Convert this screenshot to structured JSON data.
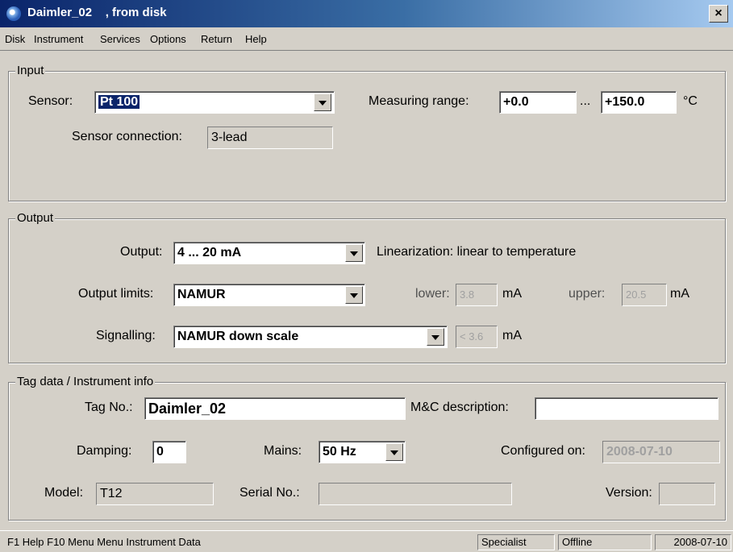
{
  "window": {
    "title": "Daimler_02    , from disk",
    "close": "×"
  },
  "menu": [
    "Disk",
    "Instrument",
    "Services",
    "Options",
    "Return",
    "Help"
  ],
  "input": {
    "legend": "Input",
    "sensor_label": "Sensor:",
    "sensor_value": "Pt 100",
    "range_label": "Measuring range:",
    "range_from": "+0.0",
    "range_sep": "...",
    "range_to": "+150.0",
    "range_unit": "°C",
    "connection_label": "Sensor connection:",
    "connection_value": "3-lead"
  },
  "output": {
    "legend": "Output",
    "output_label": "Output:",
    "output_value": "4 ... 20 mA",
    "linearization": "Linearization: linear to temperature",
    "limits_label": "Output limits:",
    "limits_value": "NAMUR",
    "lower_label": "lower:",
    "lower_value": "3.8",
    "lower_unit": "mA",
    "upper_label": "upper:",
    "upper_value": "20.5",
    "upper_unit": "mA",
    "signalling_label": "Signalling:",
    "signalling_value": "NAMUR down scale",
    "signal_value": "< 3.6",
    "signal_unit": "mA"
  },
  "tag": {
    "legend": "Tag data / Instrument info",
    "tagno_label": "Tag No.:",
    "tagno_value": "Daimler_02",
    "mc_label": "M&C description:",
    "mc_value": "",
    "damping_label": "Damping:",
    "damping_value": "0",
    "mains_label": "Mains:",
    "mains_value": "50 Hz",
    "configured_label": "Configured on:",
    "configured_value": "2008-07-10",
    "model_label": "Model:",
    "model_value": "T12",
    "serial_label": "Serial No.:",
    "serial_value": "",
    "version_label": "Version:",
    "version_value": ""
  },
  "status": {
    "help": "F1 Help  F10 Menu   Menu Instrument Data",
    "role": "Specialist",
    "mode": "Offline",
    "date": "2008-07-10"
  }
}
